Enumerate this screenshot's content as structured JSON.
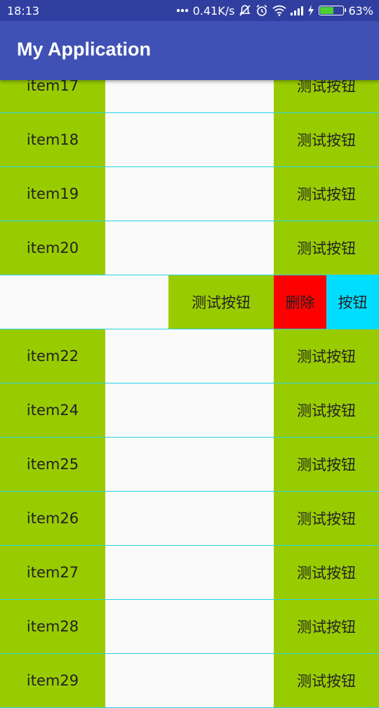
{
  "status_bar": {
    "time": "18:13",
    "network_speed": "0.41K/s",
    "battery_level": 0.63,
    "battery_text": "63%",
    "icons": [
      "ellipsis-icon",
      "mute-icon",
      "alarm-icon",
      "wifi-icon",
      "signal-icon",
      "charging-icon",
      "battery-icon"
    ]
  },
  "app_bar": {
    "title": "My Application"
  },
  "colors": {
    "status_bar": "#303f9f",
    "app_bar": "#3f51b5",
    "row_green": "#99cc00",
    "delete_red": "#ff0000",
    "extra_cyan": "#00ddff",
    "divider": "#27d4e6"
  },
  "list": {
    "rows": [
      {
        "label": "item17",
        "button": "测试按钮"
      },
      {
        "label": "item18",
        "button": "测试按钮"
      },
      {
        "label": "item19",
        "button": "测试按钮"
      },
      {
        "label": "item20",
        "button": "测试按钮"
      },
      {
        "label": "",
        "button": "测试按钮",
        "delete": "删除",
        "extra": "按钮"
      },
      {
        "label": "item22",
        "button": "测试按钮"
      },
      {
        "label": "item24",
        "button": "测试按钮"
      },
      {
        "label": "item25",
        "button": "测试按钮"
      },
      {
        "label": "item26",
        "button": "测试按钮"
      },
      {
        "label": "item27",
        "button": "测试按钮"
      },
      {
        "label": "item28",
        "button": "测试按钮"
      },
      {
        "label": "item29",
        "button": "测试按钮"
      }
    ]
  }
}
